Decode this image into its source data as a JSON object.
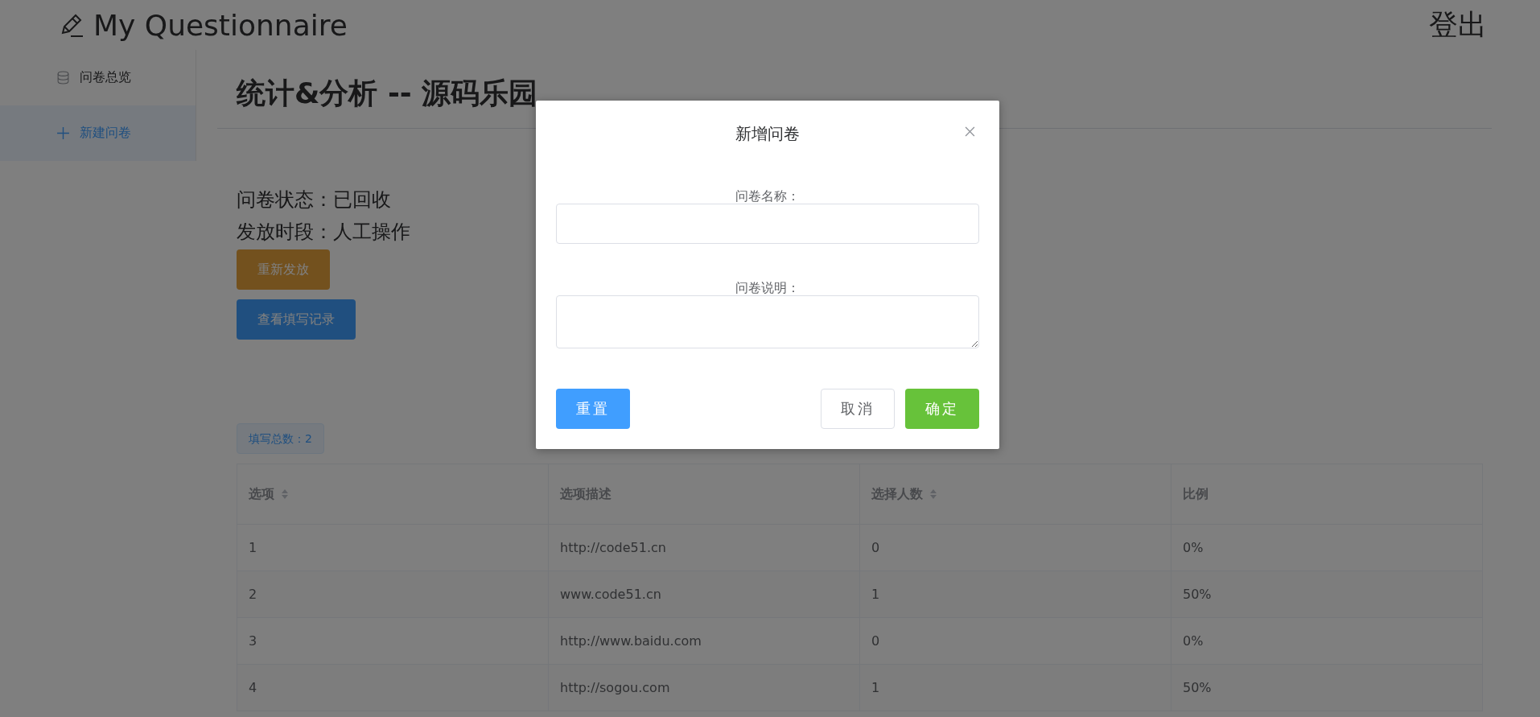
{
  "header": {
    "title": "My Questionnaire",
    "logout": "登出"
  },
  "sidebar": {
    "items": [
      {
        "label": "问卷总览",
        "kind": "database",
        "selected": false
      },
      {
        "label": "新建问卷",
        "kind": "plus",
        "selected": true
      }
    ]
  },
  "page": {
    "title": "统计&分析 -- 源码乐园",
    "status": "问卷状态：已回收",
    "period": "发放时段：人工操作",
    "buttons": [
      {
        "label": "重新发放",
        "kind": "warning"
      },
      {
        "label": "查看填写记录",
        "kind": "primary"
      }
    ],
    "total_tag": "填写总数：2"
  },
  "table": {
    "columns": [
      {
        "label": "选项",
        "sortable": true
      },
      {
        "label": "选项描述",
        "sortable": false
      },
      {
        "label": "选择人数",
        "sortable": true
      },
      {
        "label": "比例",
        "sortable": false
      }
    ],
    "rows": [
      [
        "1",
        "http://code51.cn",
        "0",
        "0%"
      ],
      [
        "2",
        "www.code51.cn",
        "1",
        "50%"
      ],
      [
        "3",
        "http://www.baidu.com",
        "0",
        "0%"
      ],
      [
        "4",
        "http://sogou.com",
        "1",
        "50%"
      ]
    ]
  },
  "dialog": {
    "title": "新增问卷",
    "fields": [
      {
        "label": "问卷名称：",
        "kind": "input"
      },
      {
        "label": "问卷说明：",
        "kind": "textarea"
      }
    ],
    "reset": "重置",
    "cancel": "取消",
    "confirm": "确定"
  }
}
